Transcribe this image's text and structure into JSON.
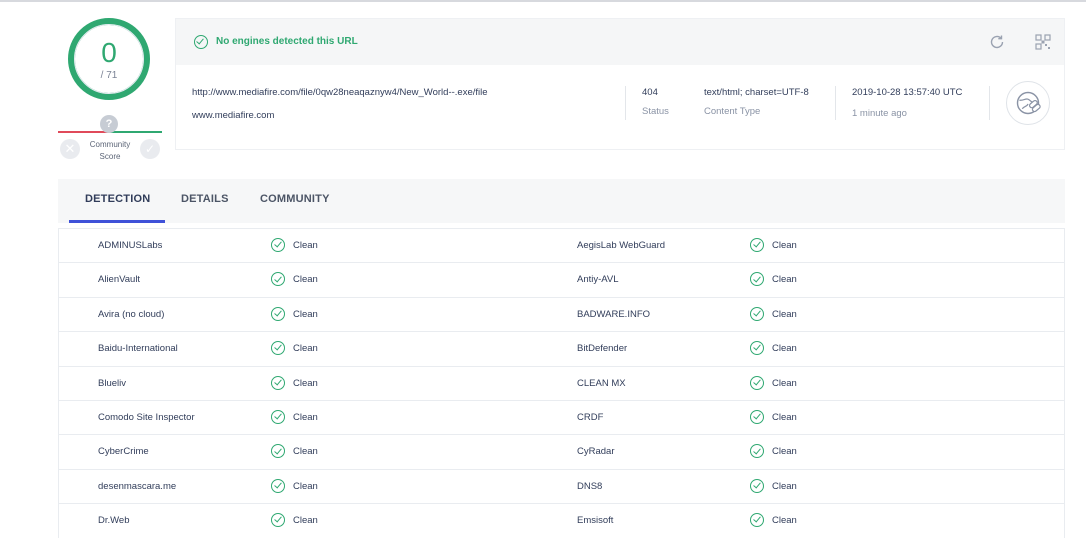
{
  "score": {
    "detections": "0",
    "total": "/ 71",
    "community_label": "Community Score",
    "community_unknown": "?",
    "colors": {
      "accent_green": "#2fa871",
      "accent_red": "#e04a5a",
      "tab_indicator": "#3f51d8"
    }
  },
  "summary": {
    "status_text": "No engines detected this URL",
    "url": "http://www.mediafire.com/file/0qw28neaqaznyw4/New_World--.exe/file",
    "host": "www.mediafire.com",
    "status_value": "404",
    "status_label": "Status",
    "content_type_value": "text/html; charset=UTF-8",
    "content_type_label": "Content Type",
    "date_value": "2019-10-28 13:57:40 UTC",
    "date_relative": "1 minute ago",
    "icons": [
      "reload-icon",
      "qr-code-icon",
      "globe-link-icon"
    ]
  },
  "tabs": [
    {
      "label": "DETECTION",
      "active": true
    },
    {
      "label": "DETAILS",
      "active": false
    },
    {
      "label": "COMMUNITY",
      "active": false
    }
  ],
  "detections": [
    {
      "left": {
        "engine": "ADMINUSLabs",
        "result": "Clean"
      },
      "right": {
        "engine": "AegisLab WebGuard",
        "result": "Clean"
      }
    },
    {
      "left": {
        "engine": "AlienVault",
        "result": "Clean"
      },
      "right": {
        "engine": "Antiy-AVL",
        "result": "Clean"
      }
    },
    {
      "left": {
        "engine": "Avira (no cloud)",
        "result": "Clean"
      },
      "right": {
        "engine": "BADWARE.INFO",
        "result": "Clean"
      }
    },
    {
      "left": {
        "engine": "Baidu-International",
        "result": "Clean"
      },
      "right": {
        "engine": "BitDefender",
        "result": "Clean"
      }
    },
    {
      "left": {
        "engine": "Blueliv",
        "result": "Clean"
      },
      "right": {
        "engine": "CLEAN MX",
        "result": "Clean"
      }
    },
    {
      "left": {
        "engine": "Comodo Site Inspector",
        "result": "Clean"
      },
      "right": {
        "engine": "CRDF",
        "result": "Clean"
      }
    },
    {
      "left": {
        "engine": "CyberCrime",
        "result": "Clean"
      },
      "right": {
        "engine": "CyRadar",
        "result": "Clean"
      }
    },
    {
      "left": {
        "engine": "desenmascara.me",
        "result": "Clean"
      },
      "right": {
        "engine": "DNS8",
        "result": "Clean"
      }
    },
    {
      "left": {
        "engine": "Dr.Web",
        "result": "Clean"
      },
      "right": {
        "engine": "Emsisoft",
        "result": "Clean"
      }
    }
  ]
}
